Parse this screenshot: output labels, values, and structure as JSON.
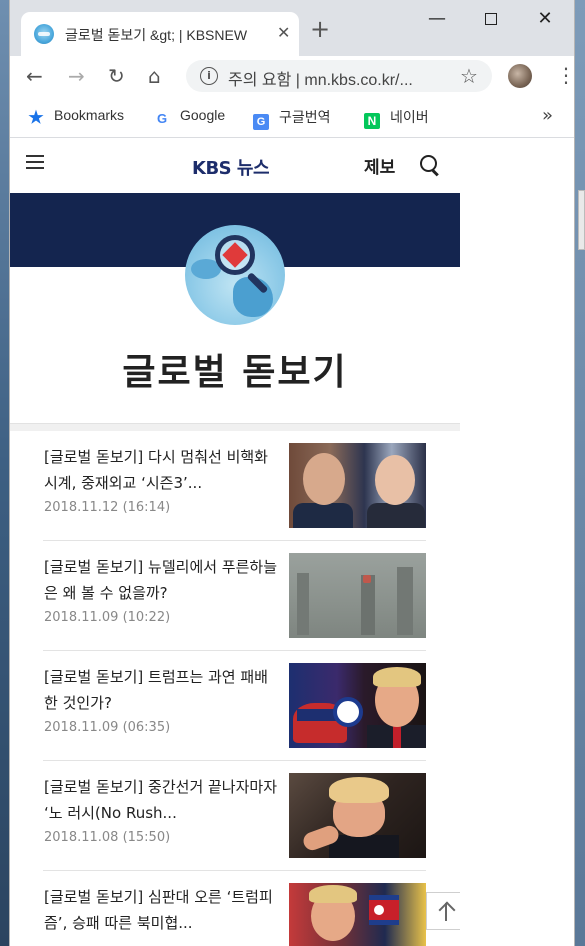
{
  "browser": {
    "tab_title": "글로벌 돋보기 &gt; | KBSNEW",
    "tab_close": "✕",
    "new_tab": "+",
    "window_controls": {
      "minimize": "—",
      "close": "✕"
    },
    "address": "주의 요함 | mn.kbs.co.kr/...",
    "nav_icons": [
      "back-icon",
      "forward-icon",
      "reload-icon",
      "home-icon"
    ],
    "bookmarks": [
      {
        "label": "Bookmarks",
        "icon": "star-icon"
      },
      {
        "label": "Google",
        "icon": "google-icon"
      },
      {
        "label": "구글번역",
        "icon": "translate-icon"
      },
      {
        "label": "네이버",
        "icon": "naver-icon"
      }
    ],
    "bookmarks_overflow": "»"
  },
  "site": {
    "logo_kbs": "KBS",
    "logo_news": "뉴스",
    "report_label": "제보",
    "brand_color": "#14254f"
  },
  "page": {
    "title": "글로벌 돋보기"
  },
  "articles": [
    {
      "title": "[글로벌 돋보기] 다시 멈춰선 비핵화 시계, 중재외교 ‘시즌3’...",
      "date": "2018.11.12 (16:14)"
    },
    {
      "title": "[글로벌 돋보기] 뉴델리에서 푸른하늘은 왜 볼 수 없을까?",
      "date": "2018.11.09 (10:22)"
    },
    {
      "title": "[글로벌 돋보기] 트럼프는 과연 패배한 것인가?",
      "date": "2018.11.09 (06:35)"
    },
    {
      "title": "[글로벌 돋보기] 중간선거 끝나자마자 ‘노 러시(No Rush...",
      "date": "2018.11.08 (15:50)"
    },
    {
      "title": "[글로벌 돋보기] 심판대 오른 ‘트럼피즘’, 승패 따른 북미협...",
      "date": ""
    }
  ]
}
